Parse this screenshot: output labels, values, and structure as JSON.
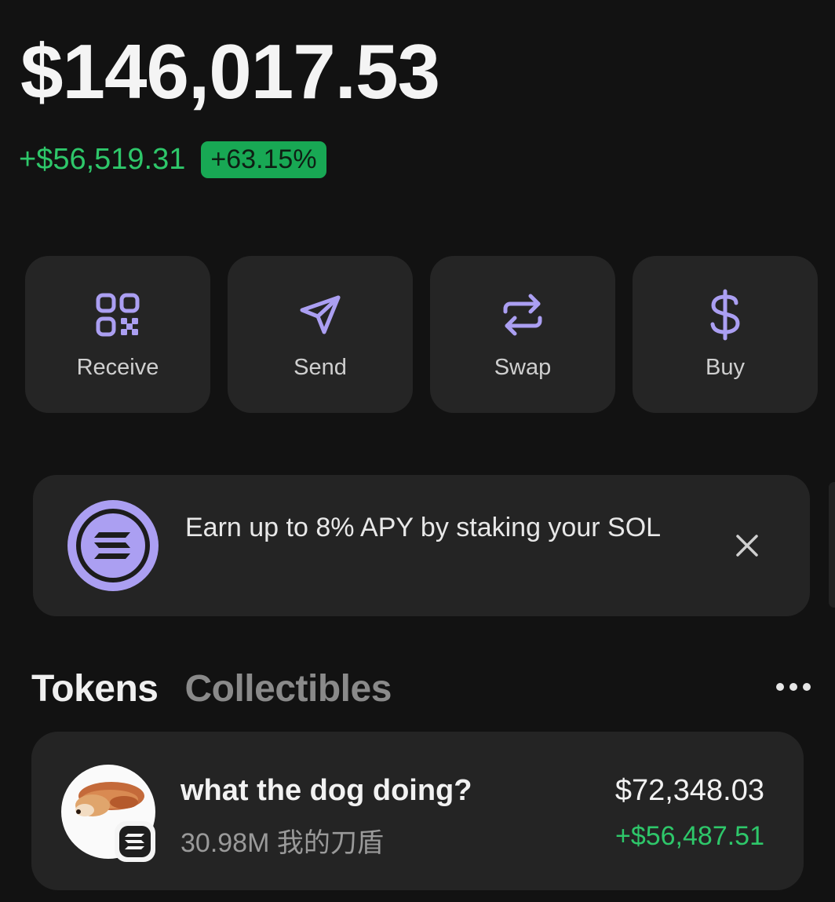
{
  "portfolio": {
    "balance": "$146,017.53",
    "change_amount": "+$56,519.31",
    "change_percent": "+63.15%"
  },
  "actions": [
    {
      "label": "Receive",
      "icon": "qr-code-icon"
    },
    {
      "label": "Send",
      "icon": "send-icon"
    },
    {
      "label": "Swap",
      "icon": "swap-icon"
    },
    {
      "label": "Buy",
      "icon": "dollar-icon"
    }
  ],
  "banner": {
    "text": "Earn up to 8% APY by staking your SOL",
    "icon": "solana-icon"
  },
  "tabs": [
    {
      "label": "Tokens",
      "active": true
    },
    {
      "label": "Collectibles",
      "active": false
    }
  ],
  "tokens": [
    {
      "name": "what the dog doing?",
      "quantity": "30.98M 我的刀盾",
      "value": "$72,348.03",
      "change": "+$56,487.51"
    }
  ],
  "colors": {
    "background": "#121212",
    "card": "#242424",
    "accent_purple": "#ab9ff2",
    "positive_green": "#2ec76a",
    "badge_green": "#18a854"
  }
}
